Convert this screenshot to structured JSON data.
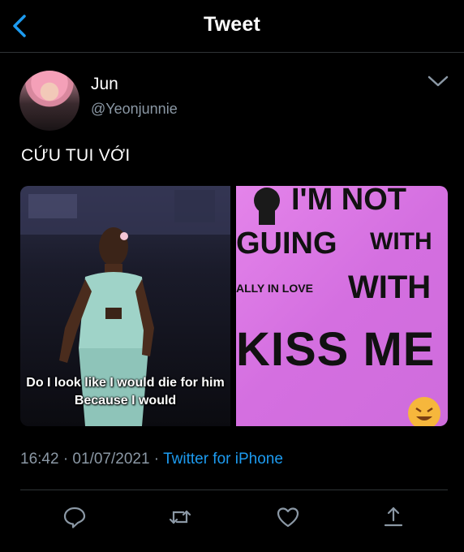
{
  "header": {
    "title": "Tweet",
    "back_icon": "chevron-left-icon"
  },
  "tweet": {
    "author": {
      "name": "Jun",
      "handle": "@Yeonjunnie"
    },
    "text": "CỨU TUI VỚI",
    "media": {
      "left": {
        "caption_line1": "Do I look like I would die for him",
        "caption_line2": "Because I would"
      },
      "right": {
        "line1": "I'M NOT",
        "line2": "GUING",
        "line3": "WITH",
        "line4": "ALLY IN LOVE",
        "line5": "WITH",
        "line6": "KISS ME"
      }
    },
    "timestamp": "16:42 · 01/07/2021 · ",
    "source": "Twitter for iPhone"
  },
  "actions": [
    "reply-icon",
    "retweet-icon",
    "like-icon",
    "share-icon"
  ],
  "colors": {
    "accent": "#1d9bf0",
    "muted": "#8b98a5",
    "background": "#000000"
  }
}
